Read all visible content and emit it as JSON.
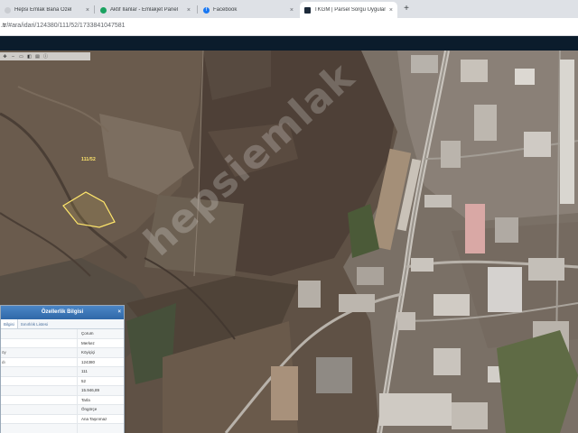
{
  "tabs": [
    {
      "title": "Hepsi Emlak Bana Özel",
      "icon": "page-icon",
      "active": false
    },
    {
      "title": "Aktif İlanlar - Emlakjet Panel",
      "icon": "emlakjet-icon",
      "active": false
    },
    {
      "title": "Facebook",
      "icon": "facebook-icon",
      "active": false
    },
    {
      "title": "TKGM | Parsel Sorgu Uygulaması",
      "icon": "tkgm-icon",
      "active": true
    }
  ],
  "new_tab_label": "+",
  "close_glyph": "×",
  "address": {
    "host": ".tr",
    "path": "/#ara/idari/124380/111/52/1733841047581"
  },
  "map": {
    "parcel_label": "111/52",
    "watermark": "hepsiemlak"
  },
  "panel": {
    "title": "Özellerlik Bilgisi",
    "close_glyph": "×",
    "tabs": [
      "Bilgisi",
      "Sınırlılık Listesi"
    ],
    "rows": [
      {
        "key": "",
        "value": "Çorum"
      },
      {
        "key": "",
        "value": "Merkez"
      },
      {
        "key": "öy",
        "value": "Köyiçiçi"
      },
      {
        "key": "dı",
        "value": "124380"
      },
      {
        "key": "",
        "value": "111"
      },
      {
        "key": "",
        "value": "52"
      },
      {
        "key": "",
        "value": "15.946,89"
      },
      {
        "key": "",
        "value": "Tarla"
      },
      {
        "key": "",
        "value": "Öngörçe"
      },
      {
        "key": "",
        "value": "Ana Taşınmaz"
      },
      {
        "key": "",
        "value": ""
      }
    ]
  },
  "colors": {
    "tab_bar": "#dee1e6",
    "app_bar": "#0b1c2c",
    "panel_header": "#2f68a8",
    "parcel_outline": "#ffe66b"
  }
}
